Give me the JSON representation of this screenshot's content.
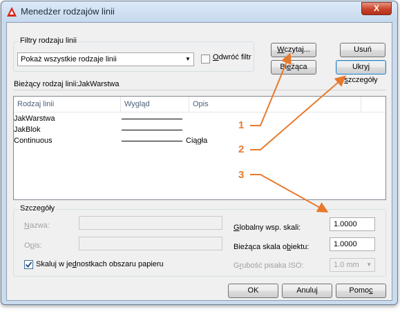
{
  "window": {
    "title": "Menedżer rodzajów linii",
    "close_glyph": "X"
  },
  "filters": {
    "group_label": "Filtry rodzaju linii",
    "combo_value": "Pokaż wszystkie rodzaje linii",
    "invert_label_ul": "O",
    "invert_label_rest": "dwróć filtr",
    "invert_checked": false
  },
  "buttons": {
    "load_ul": "W",
    "load_rest": "czytaj...",
    "delete": "Usuń",
    "current_pre": "Bi",
    "current_ul": "e",
    "current_post": "żąca",
    "hide_details_pre": "Ukryj ",
    "hide_details_ul": "s",
    "hide_details_post": "zczegóły",
    "ok": "OK",
    "cancel": "Anuluj",
    "help_pre": "Pomo",
    "help_ul": "c"
  },
  "current_linetype": {
    "label": "Bieżący rodzaj linii:",
    "value": "JakWarstwa"
  },
  "table": {
    "columns": [
      "Rodzaj linii",
      "Wygląd",
      "Opis"
    ],
    "rows": [
      {
        "name": "JakWarstwa",
        "description": ""
      },
      {
        "name": "JakBlok",
        "description": ""
      },
      {
        "name": "Continuous",
        "description": "Ciągła"
      }
    ]
  },
  "details": {
    "group_label": "Szczegóły",
    "name_ul": "N",
    "name_rest": "azwa:",
    "name_value": "",
    "desc_pre": "O",
    "desc_ul": "p",
    "desc_post": "is:",
    "desc_value": "",
    "global_scale_ul": "G",
    "global_scale_rest": "lobalny wsp. skali:",
    "global_scale_value": "1.0000",
    "object_scale_pre": "Bieżąca skala o",
    "object_scale_ul": "b",
    "object_scale_post": "iektu:",
    "object_scale_value": "1.0000",
    "paper_space_pre": "Skaluj w je",
    "paper_space_ul": "d",
    "paper_space_post": "nostkach obszaru papieru",
    "paper_space_checked": true,
    "iso_pen_pre": "G",
    "iso_pen_ul": "r",
    "iso_pen_post": "ubość pisaka ISO:",
    "iso_pen_value": "1.0 mm"
  },
  "callouts": [
    "1",
    "2",
    "3"
  ],
  "colors": {
    "callout": "#e8792b",
    "title_bar": "#c9dcef",
    "close_button": "#c8432a"
  }
}
